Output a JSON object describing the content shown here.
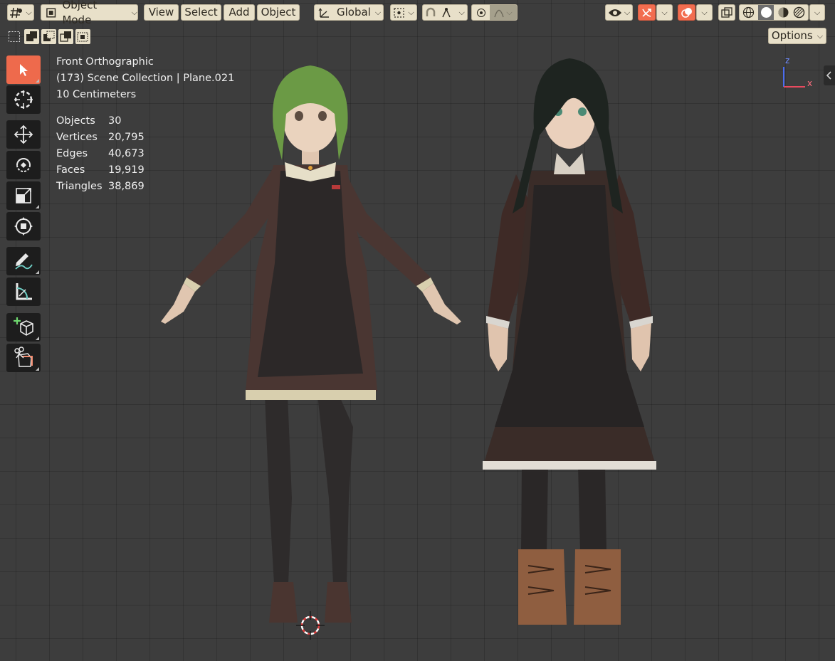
{
  "header": {
    "editor_type_icon": "grid-hash-icon",
    "mode_label": "Object Mode",
    "menus": [
      "View",
      "Select",
      "Add",
      "Object"
    ],
    "transform_orientation": "Global",
    "options_label": "Options"
  },
  "overlay": {
    "view_name": "Front Orthographic",
    "collection_line": "(173) Scene Collection | Plane.021",
    "scale_line": "10 Centimeters"
  },
  "stats": [
    {
      "label": "Objects",
      "value": "30"
    },
    {
      "label": "Vertices",
      "value": "20,795"
    },
    {
      "label": "Edges",
      "value": "40,673"
    },
    {
      "label": "Faces",
      "value": "19,919"
    },
    {
      "label": "Triangles",
      "value": "38,869"
    }
  ],
  "gizmo": {
    "z_label": "z",
    "x_label": "x"
  },
  "tools": [
    "select-box",
    "cursor",
    "move",
    "rotate",
    "scale",
    "transform",
    "annotate",
    "measure",
    "add-cube",
    "cut-tool"
  ],
  "colors": {
    "accent": "#f26d4f",
    "header_button": "#e8e0c9",
    "viewport": "#3d3d3d"
  }
}
